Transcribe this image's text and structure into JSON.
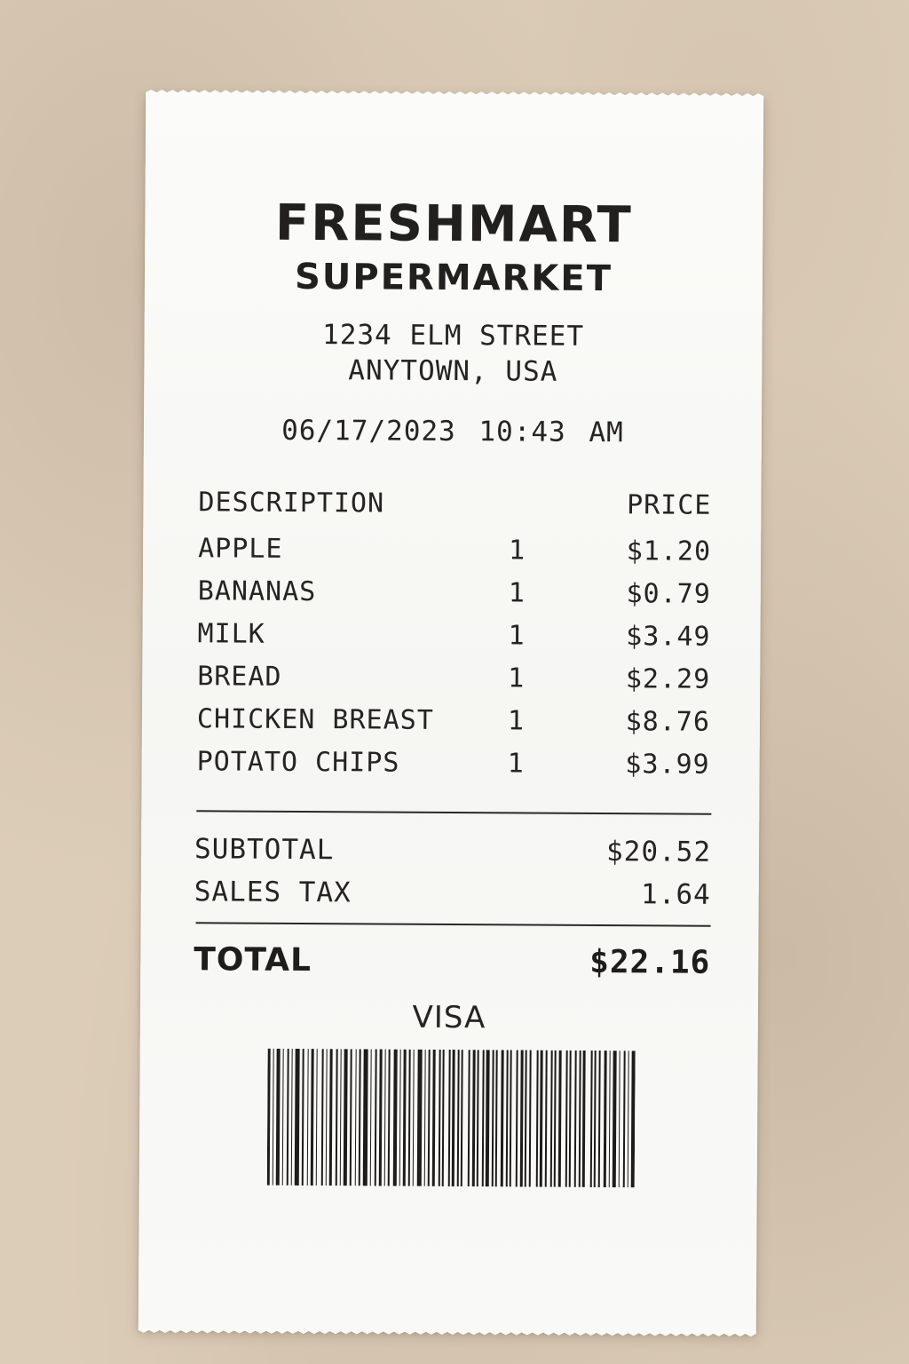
{
  "store": {
    "name_line1": "FRESHMART",
    "name_line2": "SUPERMARKET",
    "address_line1": "1234 ELM STREET",
    "address_line2": "ANYTOWN, USA"
  },
  "transaction": {
    "date": "06/17/2023",
    "time": "10:43 AM"
  },
  "columns": {
    "description": "DESCRIPTION",
    "price": "PRICE"
  },
  "items": [
    {
      "description": "APPLE",
      "qty": "1",
      "price": "$1.20"
    },
    {
      "description": "BANANAS",
      "qty": "1",
      "price": "$0.79"
    },
    {
      "description": "MILK",
      "qty": "1",
      "price": "$3.49"
    },
    {
      "description": "BREAD",
      "qty": "1",
      "price": "$2.29"
    },
    {
      "description": "CHICKEN BREAST",
      "qty": "1",
      "price": "$8.76"
    },
    {
      "description": "POTATO CHIPS",
      "qty": "1",
      "price": "$3.99"
    }
  ],
  "totals": {
    "subtotal_label": "SUBTOTAL",
    "subtotal_value": "$20.52",
    "tax_label": "SALES TAX",
    "tax_value": "1.64",
    "total_label": "TOTAL",
    "total_value": "$22.16"
  },
  "payment": {
    "method": "VISA"
  },
  "barcode_icon": "barcode-icon"
}
